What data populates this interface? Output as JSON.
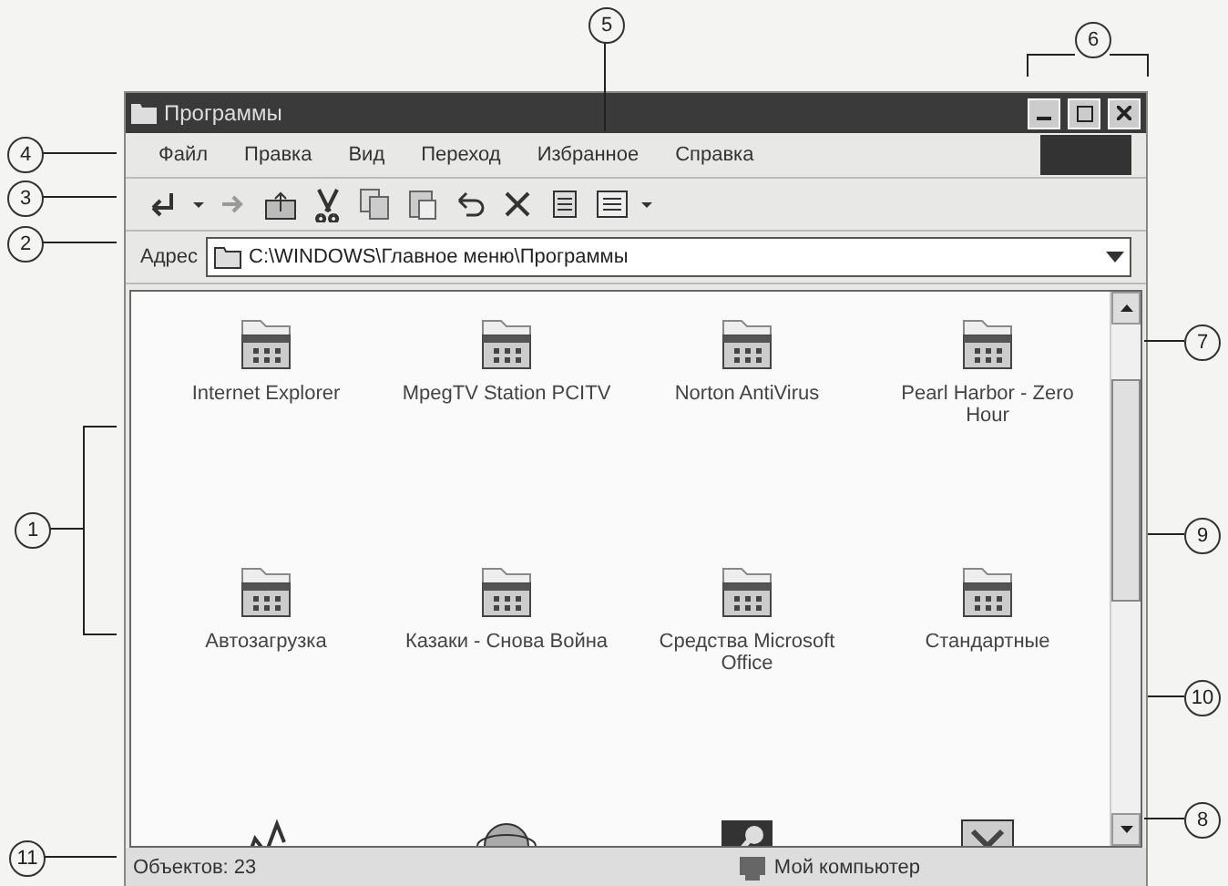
{
  "window": {
    "title": "Программы"
  },
  "menu": [
    "Файл",
    "Правка",
    "Вид",
    "Переход",
    "Избранное",
    "Справка"
  ],
  "toolbar": [
    {
      "kind": "back"
    },
    {
      "kind": "caret"
    },
    {
      "kind": "forward"
    },
    {
      "kind": "up"
    },
    {
      "kind": "cut"
    },
    {
      "kind": "copy"
    },
    {
      "kind": "paste"
    },
    {
      "kind": "undo"
    },
    {
      "kind": "delete"
    },
    {
      "kind": "properties"
    },
    {
      "kind": "views"
    },
    {
      "kind": "caret"
    }
  ],
  "address": {
    "label": "Адрес",
    "value": "C:\\WINDOWS\\Главное меню\\Программы"
  },
  "items": [
    {
      "kind": "folder",
      "label": "Internet Explorer"
    },
    {
      "kind": "folder",
      "label": "MpegTV Station PCITV"
    },
    {
      "kind": "folder",
      "label": "Norton AntiVirus"
    },
    {
      "kind": "folder",
      "label": "Pearl Harbor - Zero Hour"
    },
    {
      "kind": "folder",
      "label": "Автозагрузка"
    },
    {
      "kind": "folder",
      "label": "Казаки - Снова Война"
    },
    {
      "kind": "folder",
      "label": "Средства Microsoft Office"
    },
    {
      "kind": "folder",
      "label": "Стандартные"
    },
    {
      "kind": "chart-shortcut"
    },
    {
      "kind": "globe-shortcut"
    },
    {
      "kind": "key-shortcut"
    },
    {
      "kind": "excel-shortcut"
    }
  ],
  "status_bar": {
    "count": "Объектов: 23",
    "location": "Мой компьютер"
  },
  "callouts": [
    "5",
    "6",
    "4",
    "3",
    "2",
    "7",
    "1",
    "9",
    "10",
    "8",
    "11"
  ]
}
